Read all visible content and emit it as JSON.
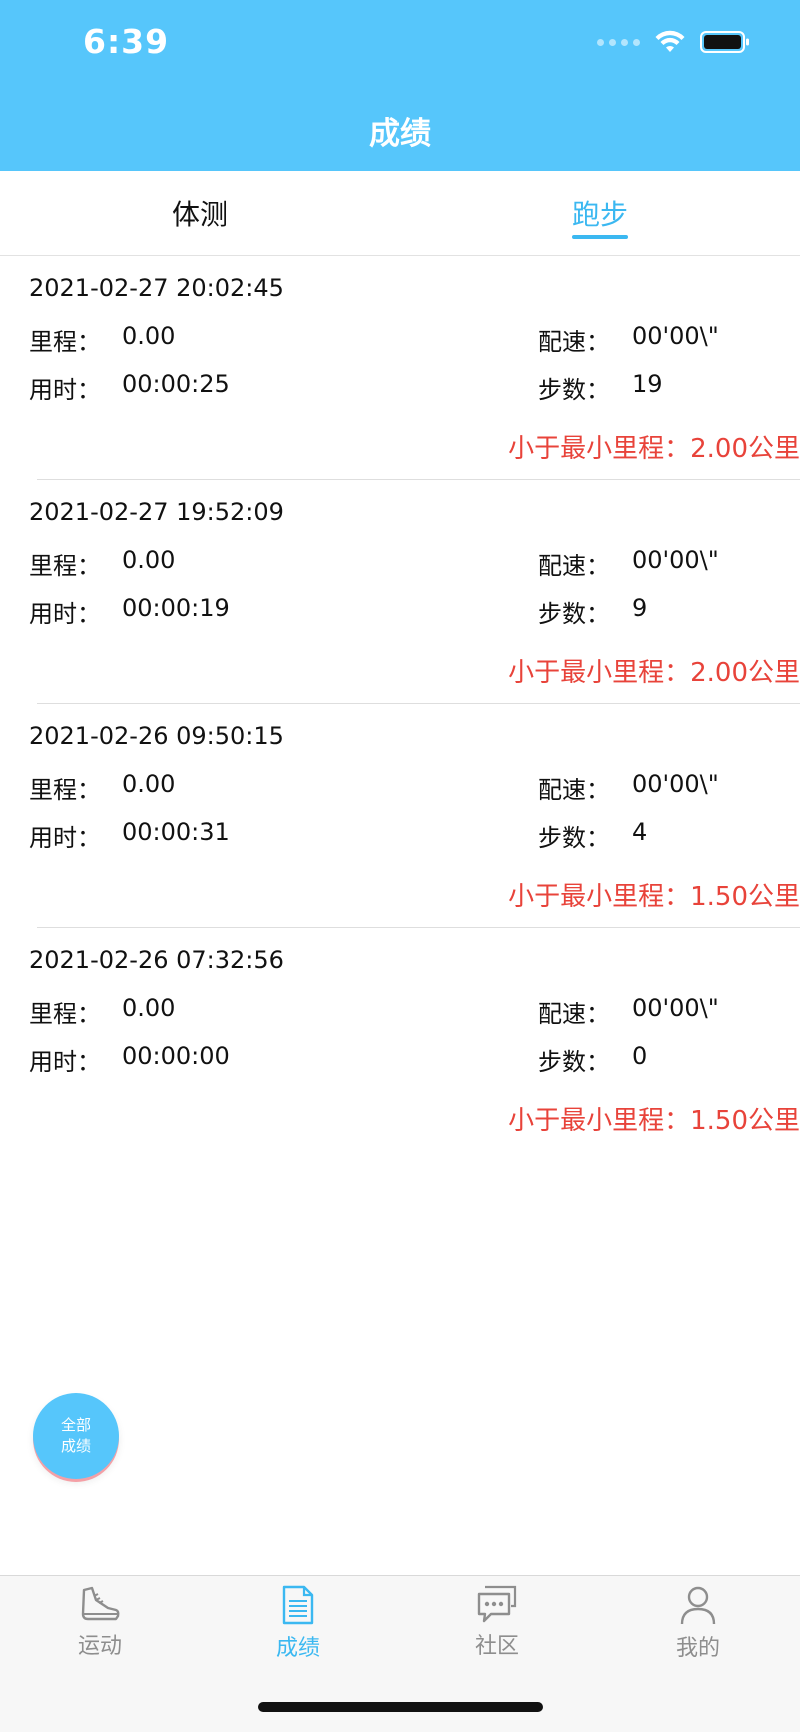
{
  "status_bar": {
    "time": "6:39"
  },
  "header": {
    "title": "成绩"
  },
  "tabs": [
    {
      "label": "体测",
      "active": false
    },
    {
      "label": "跑步",
      "active": true
    }
  ],
  "labels": {
    "distance": "里程：",
    "pace": "配速：",
    "duration": "用时：",
    "steps": "步数："
  },
  "records": [
    {
      "datetime": "2021-02-27 20:02:45",
      "distance": "0.00",
      "pace": "00'00\\\"",
      "duration": "00:00:25",
      "steps": "19",
      "warning": "小于最小里程：2.00公里"
    },
    {
      "datetime": "2021-02-27 19:52:09",
      "distance": "0.00",
      "pace": "00'00\\\"",
      "duration": "00:00:19",
      "steps": "9",
      "warning": "小于最小里程：2.00公里"
    },
    {
      "datetime": "2021-02-26 09:50:15",
      "distance": "0.00",
      "pace": "00'00\\\"",
      "duration": "00:00:31",
      "steps": "4",
      "warning": "小于最小里程：1.50公里"
    },
    {
      "datetime": "2021-02-26 07:32:56",
      "distance": "0.00",
      "pace": "00'00\\\"",
      "duration": "00:00:00",
      "steps": "0",
      "warning": "小于最小里程：1.50公里"
    }
  ],
  "fab": {
    "line1": "全部",
    "line2": "成绩"
  },
  "bottom_nav": [
    {
      "label": "运动",
      "icon": "shoe-icon",
      "active": false
    },
    {
      "label": "成绩",
      "icon": "document-icon",
      "active": true
    },
    {
      "label": "社区",
      "icon": "chat-icon",
      "active": false
    },
    {
      "label": "我的",
      "icon": "person-icon",
      "active": false
    }
  ],
  "colors": {
    "primary": "#56c6fb",
    "active_tab": "#3bb8f1",
    "warning": "#e8433a"
  }
}
